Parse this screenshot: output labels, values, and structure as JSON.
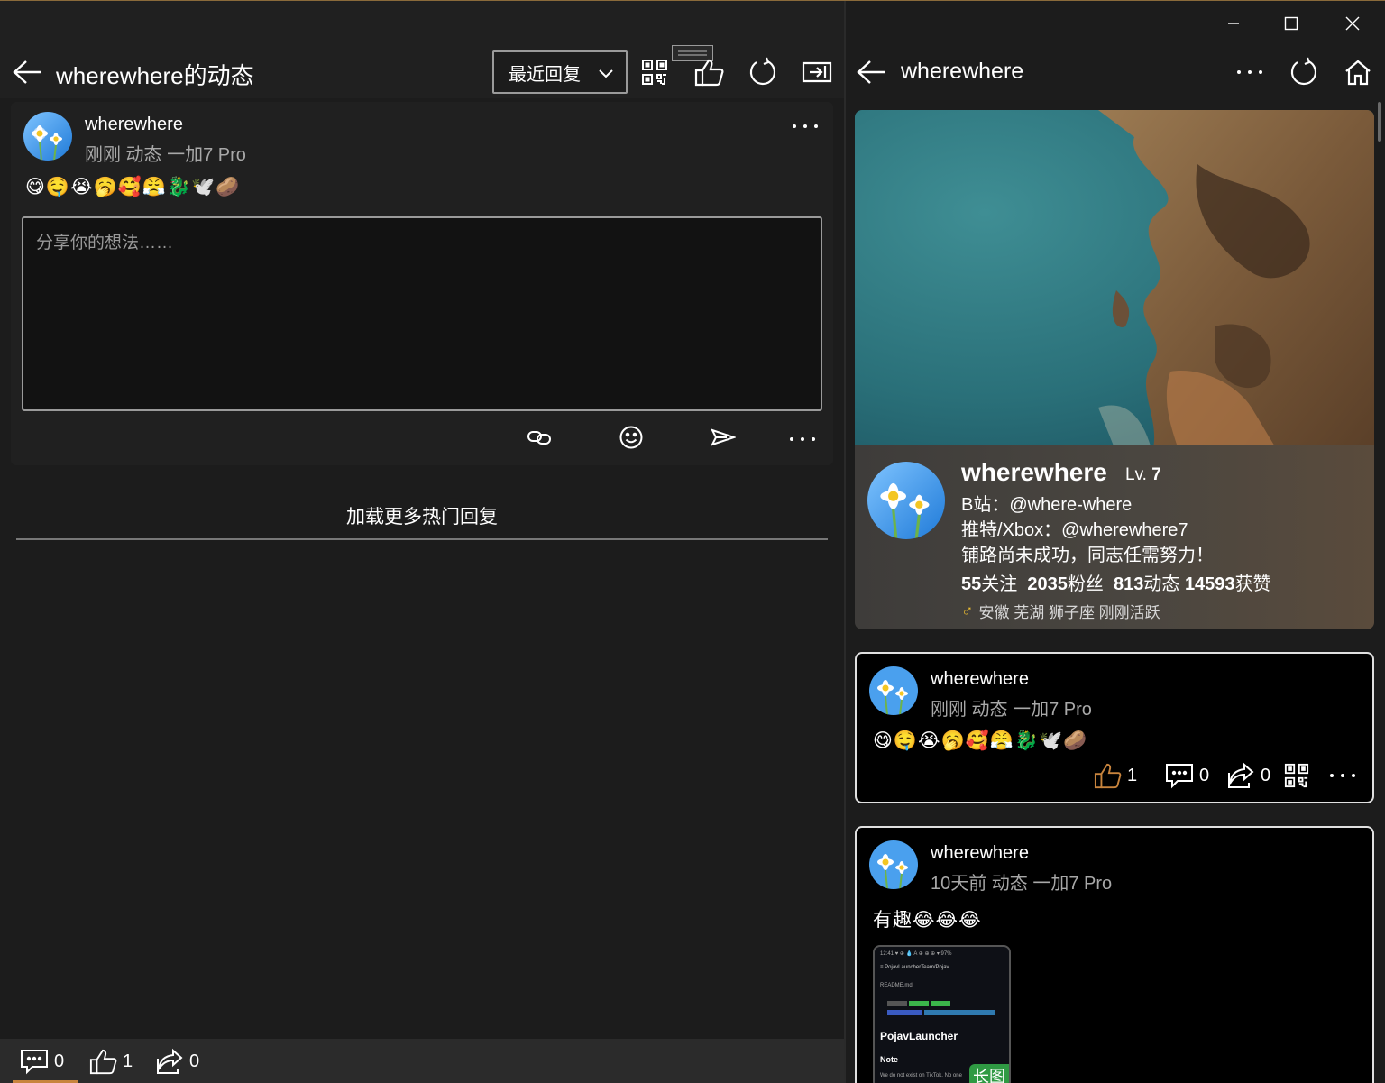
{
  "left": {
    "title": "wherewhere的动态",
    "sort_value": "最近回复",
    "post": {
      "author": "wherewhere",
      "meta": "刚刚  动态  一加7 Pro",
      "emojis": "😋🤤😭🥱🥰😤🐉🕊️🥔"
    },
    "reply_placeholder": "分享你的想法……",
    "load_more": "加载更多热门回复",
    "bottom": {
      "comments": "0",
      "likes": "1",
      "shares": "0"
    }
  },
  "right": {
    "title": "wherewhere",
    "profile": {
      "name": "wherewhere",
      "lv_label": "Lv.",
      "lv_value": "7",
      "bilibili": "B站：@where-where",
      "twitter": "推特/Xbox：@wherewhere7",
      "bio": "铺路尚未成功，同志任需努力！",
      "following_num": "55",
      "following_label": "关注",
      "fans_num": "2035",
      "fans_label": "粉丝",
      "posts_num": "813",
      "posts_label": "动态",
      "likes_num": "14593",
      "likes_label": "获赞",
      "gender_symbol": "♂",
      "location": "安徽 芜湖 狮子座 刚刚活跃"
    },
    "feed": [
      {
        "author": "wherewhere",
        "meta": "刚刚  动态  一加7 Pro",
        "text": "😋🤤😭🥱🥰😤🐉🕊️🥔",
        "likes": "1",
        "comments": "0",
        "shares": "0"
      },
      {
        "author": "wherewhere",
        "meta": "10天前  动态  一加7 Pro",
        "text": "有趣😂😂😂",
        "thumb_lines": [
          "12:41 ♥ ⊕ 💧 A            ⊕ ⊕ ⊕ ▾ 97%",
          "≡  PojavLauncherTeam/Pojav...",
          "README.md",
          "PojavLauncher",
          "Note",
          "We do not exist on TikTok. No one"
        ],
        "thumb_title": "PojavLauncher",
        "thumb_note": "Note",
        "badge": "长图"
      }
    ]
  },
  "colors": {
    "accent": "#c8843d",
    "background": "#1c1c1c",
    "header": "#202020",
    "badge": "#2f9a43"
  }
}
